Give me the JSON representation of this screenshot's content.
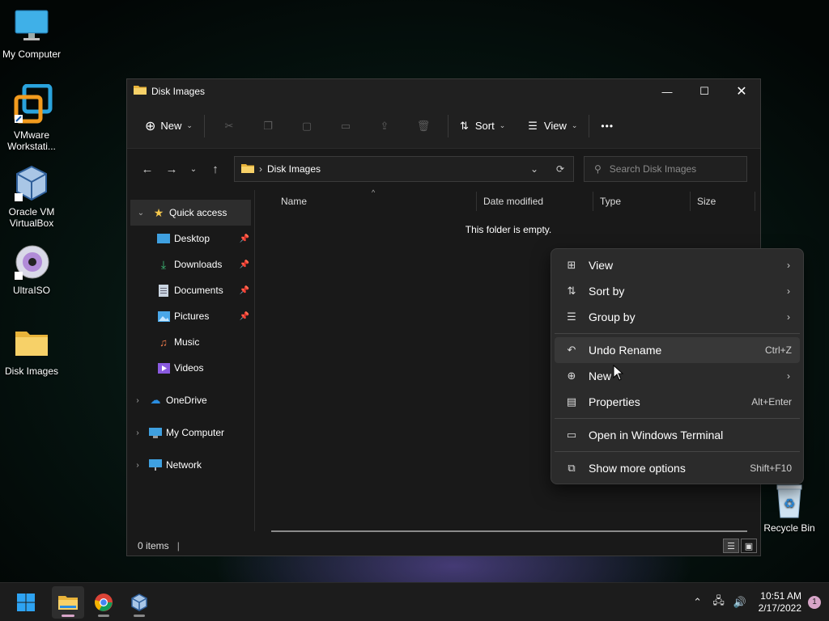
{
  "desktop": {
    "icons": [
      {
        "label": "My Computer"
      },
      {
        "label": "VMware Workstati..."
      },
      {
        "label": "Oracle VM VirtualBox"
      },
      {
        "label": "UltraISO"
      },
      {
        "label": "Disk Images"
      },
      {
        "label": "Recycle Bin"
      }
    ]
  },
  "window": {
    "title": "Disk Images",
    "toolbar": {
      "new_label": "New",
      "sort_label": "Sort",
      "view_label": "View",
      "more_label": "•••"
    },
    "address": {
      "path": "Disk Images"
    },
    "search": {
      "placeholder": "Search Disk Images"
    },
    "nav": {
      "quick_access": "Quick access",
      "items": [
        {
          "label": "Desktop"
        },
        {
          "label": "Downloads"
        },
        {
          "label": "Documents"
        },
        {
          "label": "Pictures"
        },
        {
          "label": "Music"
        },
        {
          "label": "Videos"
        }
      ],
      "onedrive": "OneDrive",
      "my_computer": "My Computer",
      "network": "Network"
    },
    "columns": {
      "name": "Name",
      "date_modified": "Date modified",
      "type": "Type",
      "size": "Size"
    },
    "empty_message": "This folder is empty.",
    "status": {
      "items_count": "0 items"
    }
  },
  "context_menu": {
    "view": "View",
    "sort_by": "Sort by",
    "group_by": "Group by",
    "undo_rename": "Undo Rename",
    "undo_shortcut": "Ctrl+Z",
    "new": "New",
    "properties": "Properties",
    "properties_shortcut": "Alt+Enter",
    "open_terminal": "Open in Windows Terminal",
    "show_more": "Show more options",
    "show_more_shortcut": "Shift+F10"
  },
  "taskbar": {
    "time": "10:51 AM",
    "date": "2/17/2022",
    "notification_count": "1"
  },
  "colors": {
    "accent": "#0078d4",
    "folder_yellow": "#f5c84c",
    "notification": "#d7a5c8"
  }
}
